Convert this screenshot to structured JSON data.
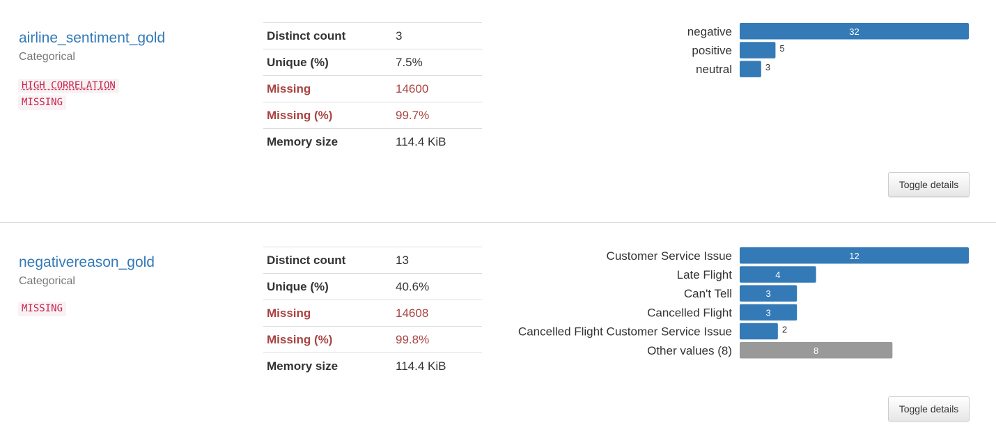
{
  "variables": [
    {
      "name": "airline_sentiment_gold",
      "type": "Categorical",
      "badges": [
        {
          "text": "HIGH CORRELATION",
          "dotted": true
        },
        {
          "text": "MISSING",
          "dotted": false
        }
      ],
      "stats": [
        {
          "label": "Distinct count",
          "value": "3",
          "alert": false
        },
        {
          "label": "Unique (%)",
          "value": "7.5%",
          "alert": false
        },
        {
          "label": "Missing",
          "value": "14600",
          "alert": true
        },
        {
          "label": "Missing (%)",
          "value": "99.7%",
          "alert": true
        },
        {
          "label": "Memory size",
          "value": "114.4 KiB",
          "alert": false
        }
      ],
      "toggle_label": "Toggle details"
    },
    {
      "name": "negativereason_gold",
      "type": "Categorical",
      "badges": [
        {
          "text": "MISSING",
          "dotted": false
        }
      ],
      "stats": [
        {
          "label": "Distinct count",
          "value": "13",
          "alert": false
        },
        {
          "label": "Unique (%)",
          "value": "40.6%",
          "alert": false
        },
        {
          "label": "Missing",
          "value": "14608",
          "alert": true
        },
        {
          "label": "Missing (%)",
          "value": "99.8%",
          "alert": true
        },
        {
          "label": "Memory size",
          "value": "114.4 KiB",
          "alert": false
        }
      ],
      "toggle_label": "Toggle details"
    }
  ],
  "colors": {
    "bar": "#337ab7",
    "other_bar": "#999999",
    "link": "#337ab7",
    "alert": "#a94442",
    "badge_text": "#c7254e",
    "badge_bg": "#f9f2f4"
  },
  "chart_data": [
    {
      "type": "bar",
      "orientation": "horizontal",
      "categories": [
        "negative",
        "positive",
        "neutral"
      ],
      "values": [
        32,
        5,
        3
      ],
      "other": [
        false,
        false,
        false
      ]
    },
    {
      "type": "bar",
      "orientation": "horizontal",
      "categories": [
        "Customer Service Issue",
        "Late Flight",
        "Can't Tell",
        "Cancelled Flight",
        "Cancelled Flight Customer Service Issue",
        "Other values (8)"
      ],
      "values": [
        12,
        4,
        3,
        3,
        2,
        8
      ],
      "other": [
        false,
        false,
        false,
        false,
        false,
        true
      ]
    }
  ]
}
